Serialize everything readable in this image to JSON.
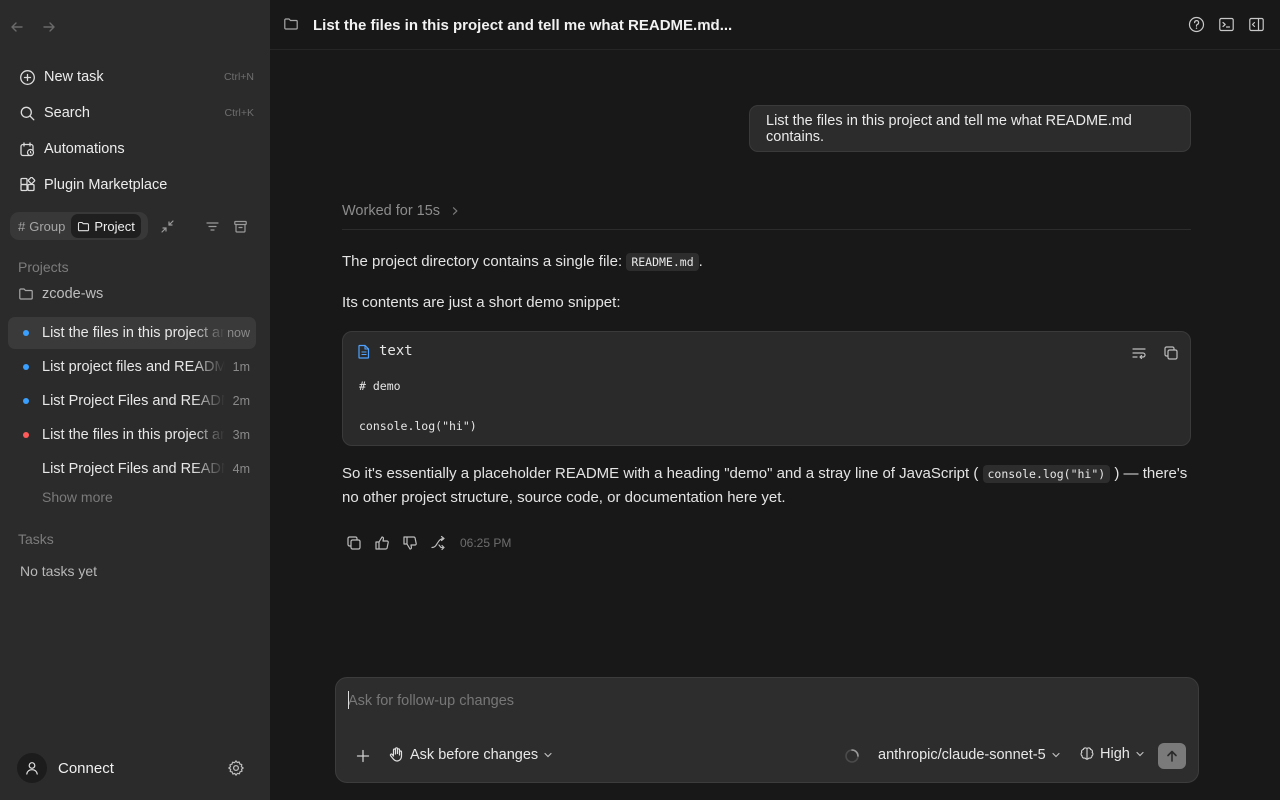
{
  "sidebar": {
    "menu": [
      {
        "label": "New task",
        "shortcut": "Ctrl+N",
        "icon": "new-task-icon"
      },
      {
        "label": "Search",
        "shortcut": "Ctrl+K",
        "icon": "search-icon"
      },
      {
        "label": "Automations",
        "shortcut": "",
        "icon": "automations-icon"
      },
      {
        "label": "Plugin Marketplace",
        "shortcut": "",
        "icon": "plugin-icon"
      }
    ],
    "view_toggle": {
      "group_label": "Group",
      "project_label": "Project",
      "active": "Project"
    },
    "projects_title": "Projects",
    "project_name": "zcode-ws",
    "threads": [
      {
        "title": "List the files in this project and tell me what README.md contains.",
        "time": "now",
        "status_color": "#3aa0ff",
        "active": true
      },
      {
        "title": "List project files and README",
        "time": "1m",
        "status_color": "#3aa0ff",
        "active": false
      },
      {
        "title": "List Project Files and README",
        "time": "2m",
        "status_color": "#3aa0ff",
        "active": false
      },
      {
        "title": "List the files in this project and tell me",
        "time": "3m",
        "status_color": "#ff5a5a",
        "active": false
      },
      {
        "title": "List Project Files and README",
        "time": "4m",
        "status_color": "",
        "active": false
      }
    ],
    "show_more": "Show more",
    "tasks_title": "Tasks",
    "tasks_empty": "No tasks yet",
    "connect_label": "Connect"
  },
  "header": {
    "title": "List the files in this project and tell me what README.md..."
  },
  "conversation": {
    "user_message": "List the files in this project and tell me what README.md contains.",
    "worked_for": "Worked for 15s",
    "p1_text": "The project directory contains a single file:",
    "p1_code": "README.md",
    "p1_end": ".",
    "p2_text": "Its contents are just a short demo snippet:",
    "code_lang": "text",
    "code_lines": [
      "# demo",
      "",
      "console.log(\"hi\")"
    ],
    "p3_before": "So it's essentially a placeholder README with a heading \"demo\" and a stray line of JavaScript (",
    "p3_code": "console.log(\"hi\")",
    "p3_after": ") — there's no other project structure, source code, or documentation here yet.",
    "timestamp": "06:25 PM"
  },
  "composer": {
    "placeholder": "Ask for follow-up changes",
    "mode_label": "Ask before changes",
    "model": "anthropic/claude-sonnet-5",
    "effort": "High"
  },
  "colors": {
    "sidebar_bg": "#2b2b2b",
    "main_bg": "#181818",
    "accent_blue": "#3aa0ff",
    "error_red": "#ff5a5a"
  }
}
